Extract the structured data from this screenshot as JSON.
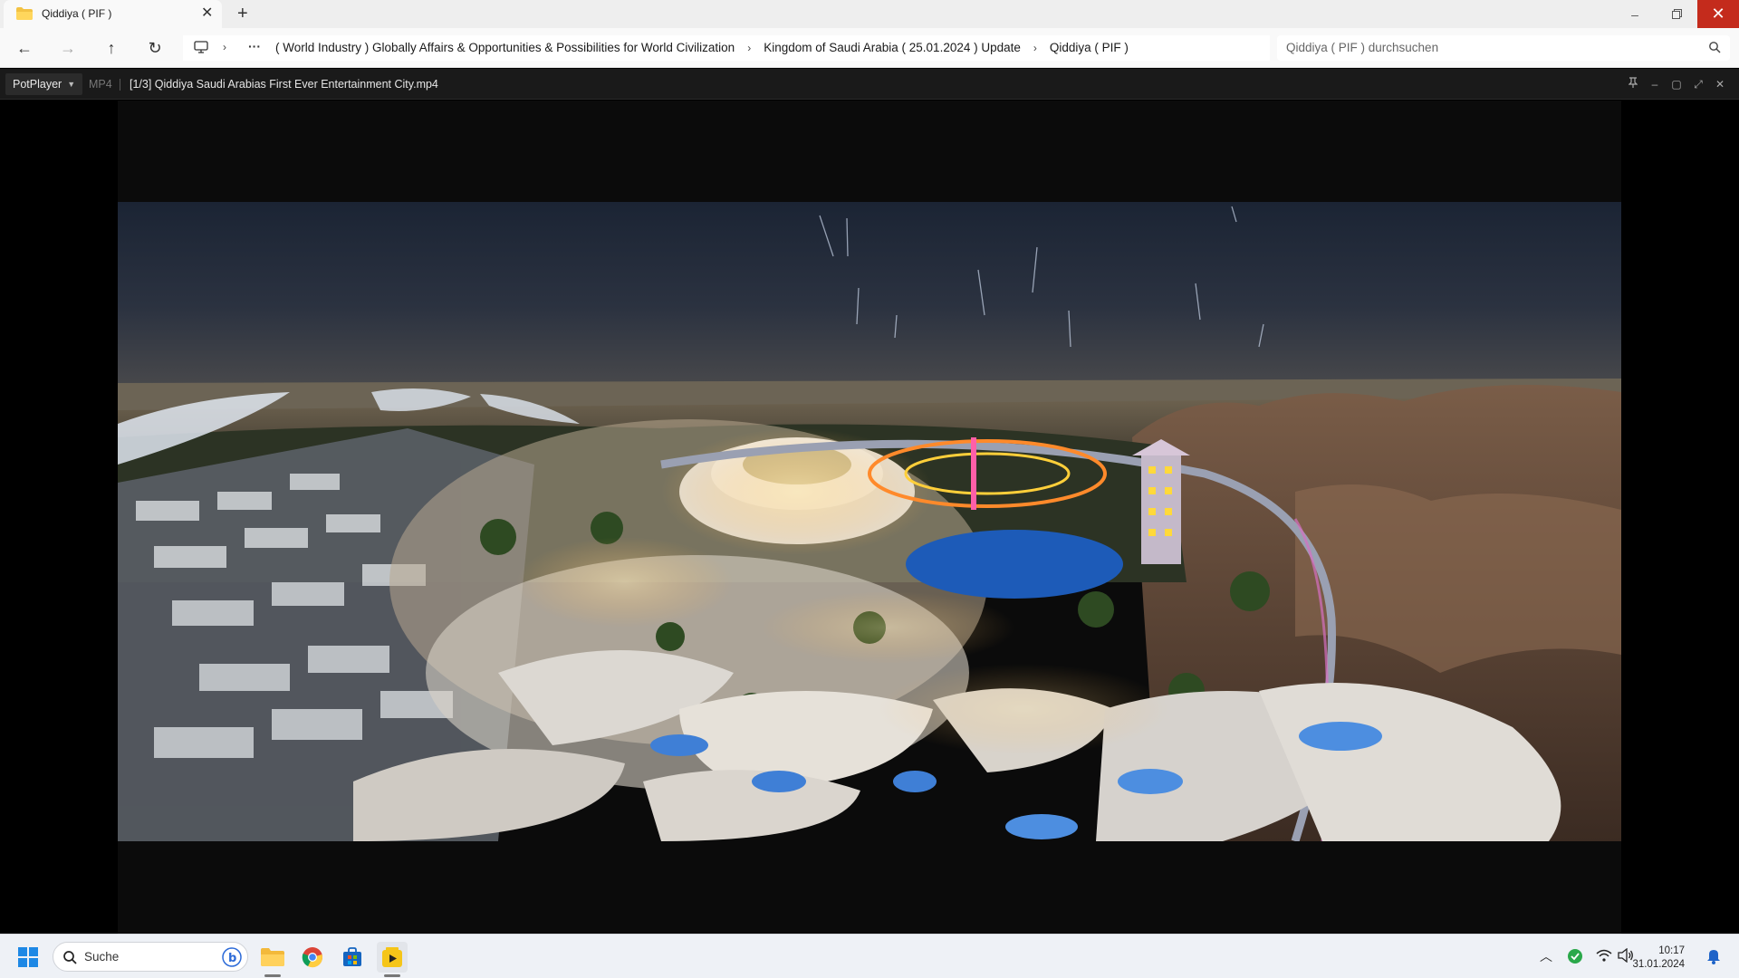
{
  "explorer": {
    "tab_title": "Qiddiya ( PIF )",
    "new_tab": "+",
    "window_controls": {
      "minimize": "–",
      "maximize": "▢",
      "close": "✕"
    },
    "nav": {
      "back": "←",
      "forward": "→",
      "up": "↑",
      "refresh": "↻"
    },
    "breadcrumbs": [
      "( World Industry ) Globally Affairs & Opportunities & Possibilities for World Civilization",
      "Kingdom of Saudi Arabia ( 25.01.2024 ) Update",
      "Qiddiya ( PIF )"
    ],
    "crumb_more": "···",
    "search_placeholder": "Qiddiya ( PIF ) durchsuchen"
  },
  "player": {
    "app_name": "PotPlayer",
    "format": "MP4",
    "file_title": "[1/3] Qiddiya  Saudi Arabias First Ever Entertainment City.mp4",
    "controls": {
      "pin": "⊼",
      "minimize": "–",
      "maximize": "▢",
      "fullscreen": "⤢",
      "close": "✕"
    }
  },
  "taskbar": {
    "search_label": "Suche",
    "time": "10:17",
    "date": "31.01.2024",
    "pinned": [
      "start-icon",
      "search-icon",
      "file-explorer-icon",
      "chrome-icon",
      "store-icon",
      "potplayer-icon"
    ],
    "tray": [
      "chevron-up-icon",
      "security-icon",
      "wifi-icon",
      "volume-icon",
      "notification-bell-icon"
    ]
  },
  "colors": {
    "close_red": "#c42b1c",
    "player_bar": "#1a1a1a",
    "taskbar_bg": "#eef1f6",
    "sky_top": "#1c2535",
    "sky_horizon": "#3a3e48"
  }
}
